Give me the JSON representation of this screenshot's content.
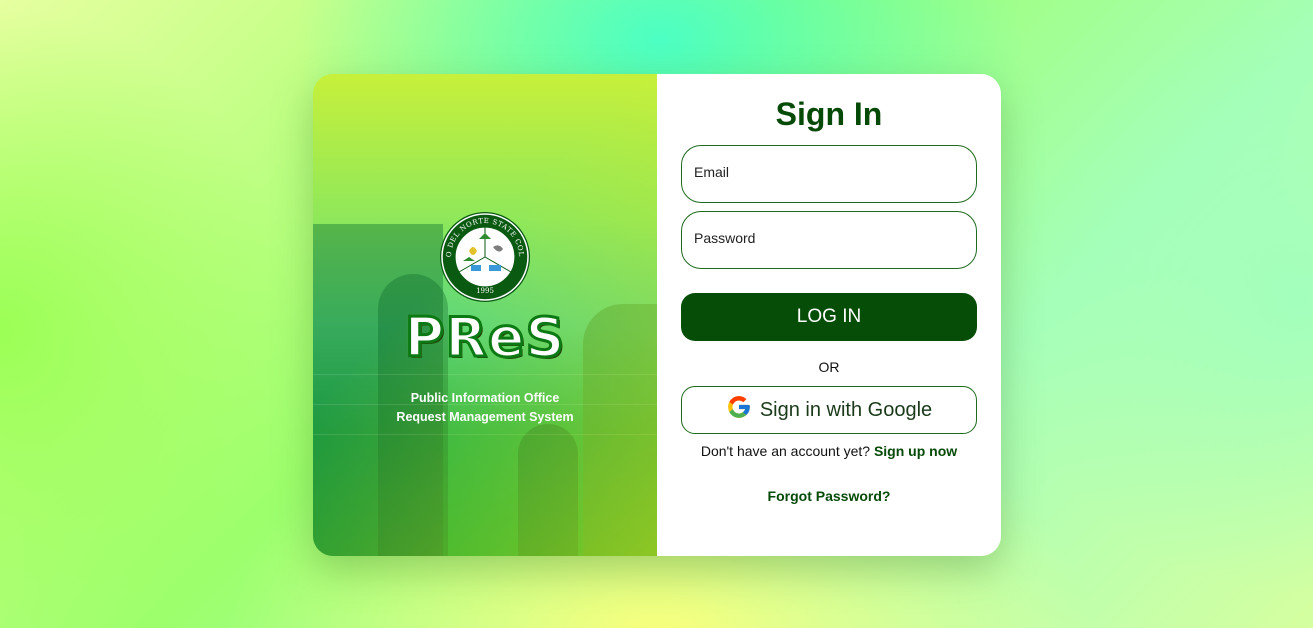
{
  "branding": {
    "seal_text": "DAVAO DEL NORTE STATE COLLEGE",
    "seal_year": "1995",
    "app_name": "PReS",
    "subtitle_line1": "Public Information Office",
    "subtitle_line2": "Request Management System"
  },
  "form": {
    "title": "Sign In",
    "email_placeholder": "Email",
    "password_placeholder": "Password",
    "login_label": "LOG IN",
    "or_label": "OR",
    "google_label": "Sign in with Google",
    "signup_prompt": "Don't have an account yet?",
    "signup_link": "Sign up now",
    "forgot_label": "Forgot Password?"
  },
  "colors": {
    "primary": "#064d08",
    "accent_border": "#1e6a1e",
    "brand_outline": "#0c7a14"
  }
}
